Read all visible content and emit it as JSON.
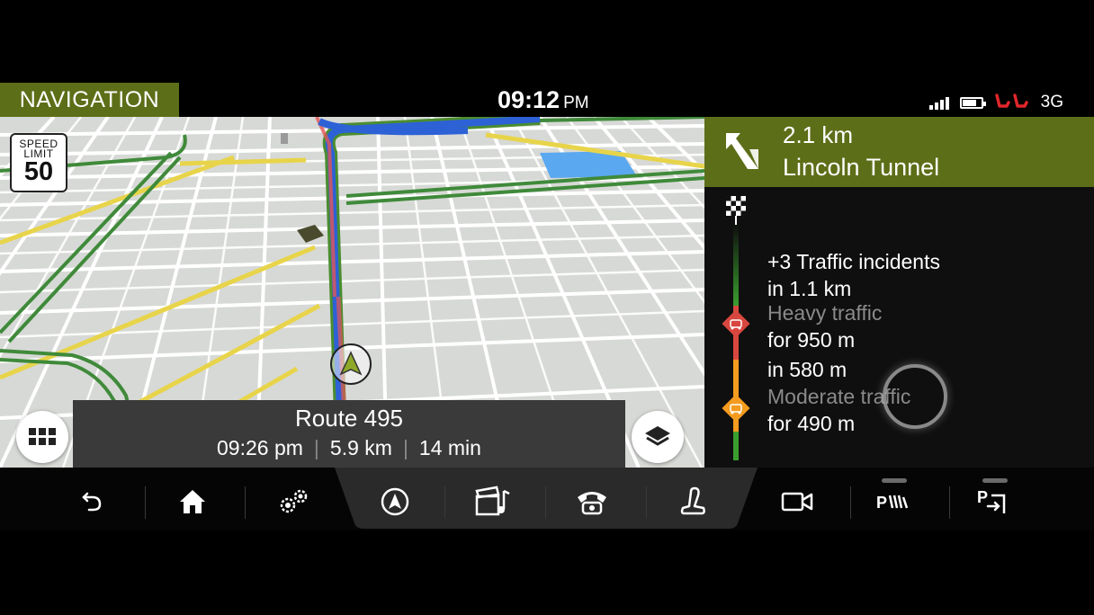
{
  "header": {
    "section_title": "NAVIGATION",
    "time": "09:12",
    "ampm": "PM",
    "network": "3G",
    "battery_level": 0.75,
    "signal_bars": 4
  },
  "map": {
    "speed_limit_label": "SPEED LIMIT",
    "speed_limit_value": "50",
    "route": {
      "name": "Route 495",
      "eta": "09:26 pm",
      "distance": "5.9 km",
      "duration": "14 min",
      "separator": "|"
    }
  },
  "guidance": {
    "distance": "2.1 km",
    "street": "Lincoln Tunnel",
    "incidents_count_text": "+3 Traffic incidents",
    "incidents_in": "in 1.1 km",
    "incident_1_type": "Heavy traffic",
    "incident_1_length": "for 950 m",
    "incident_2_in": "in 580 m",
    "incident_2_type": "Moderate traffic",
    "incident_2_length": "for 490 m",
    "colors": {
      "heavy": "#d8473f",
      "moderate": "#f39c1f",
      "clear": "#3a9e2f"
    }
  },
  "bottom_bar": {
    "items": [
      "back-icon",
      "home-icon",
      "settings-icon",
      "navigation-icon",
      "media-icon",
      "phone-icon",
      "seat-icon",
      "camera-icon",
      "park-assist-icon",
      "parking-exit-icon"
    ]
  },
  "colors": {
    "accent": "#5d6e18",
    "route_blue": "#2d61d6"
  }
}
